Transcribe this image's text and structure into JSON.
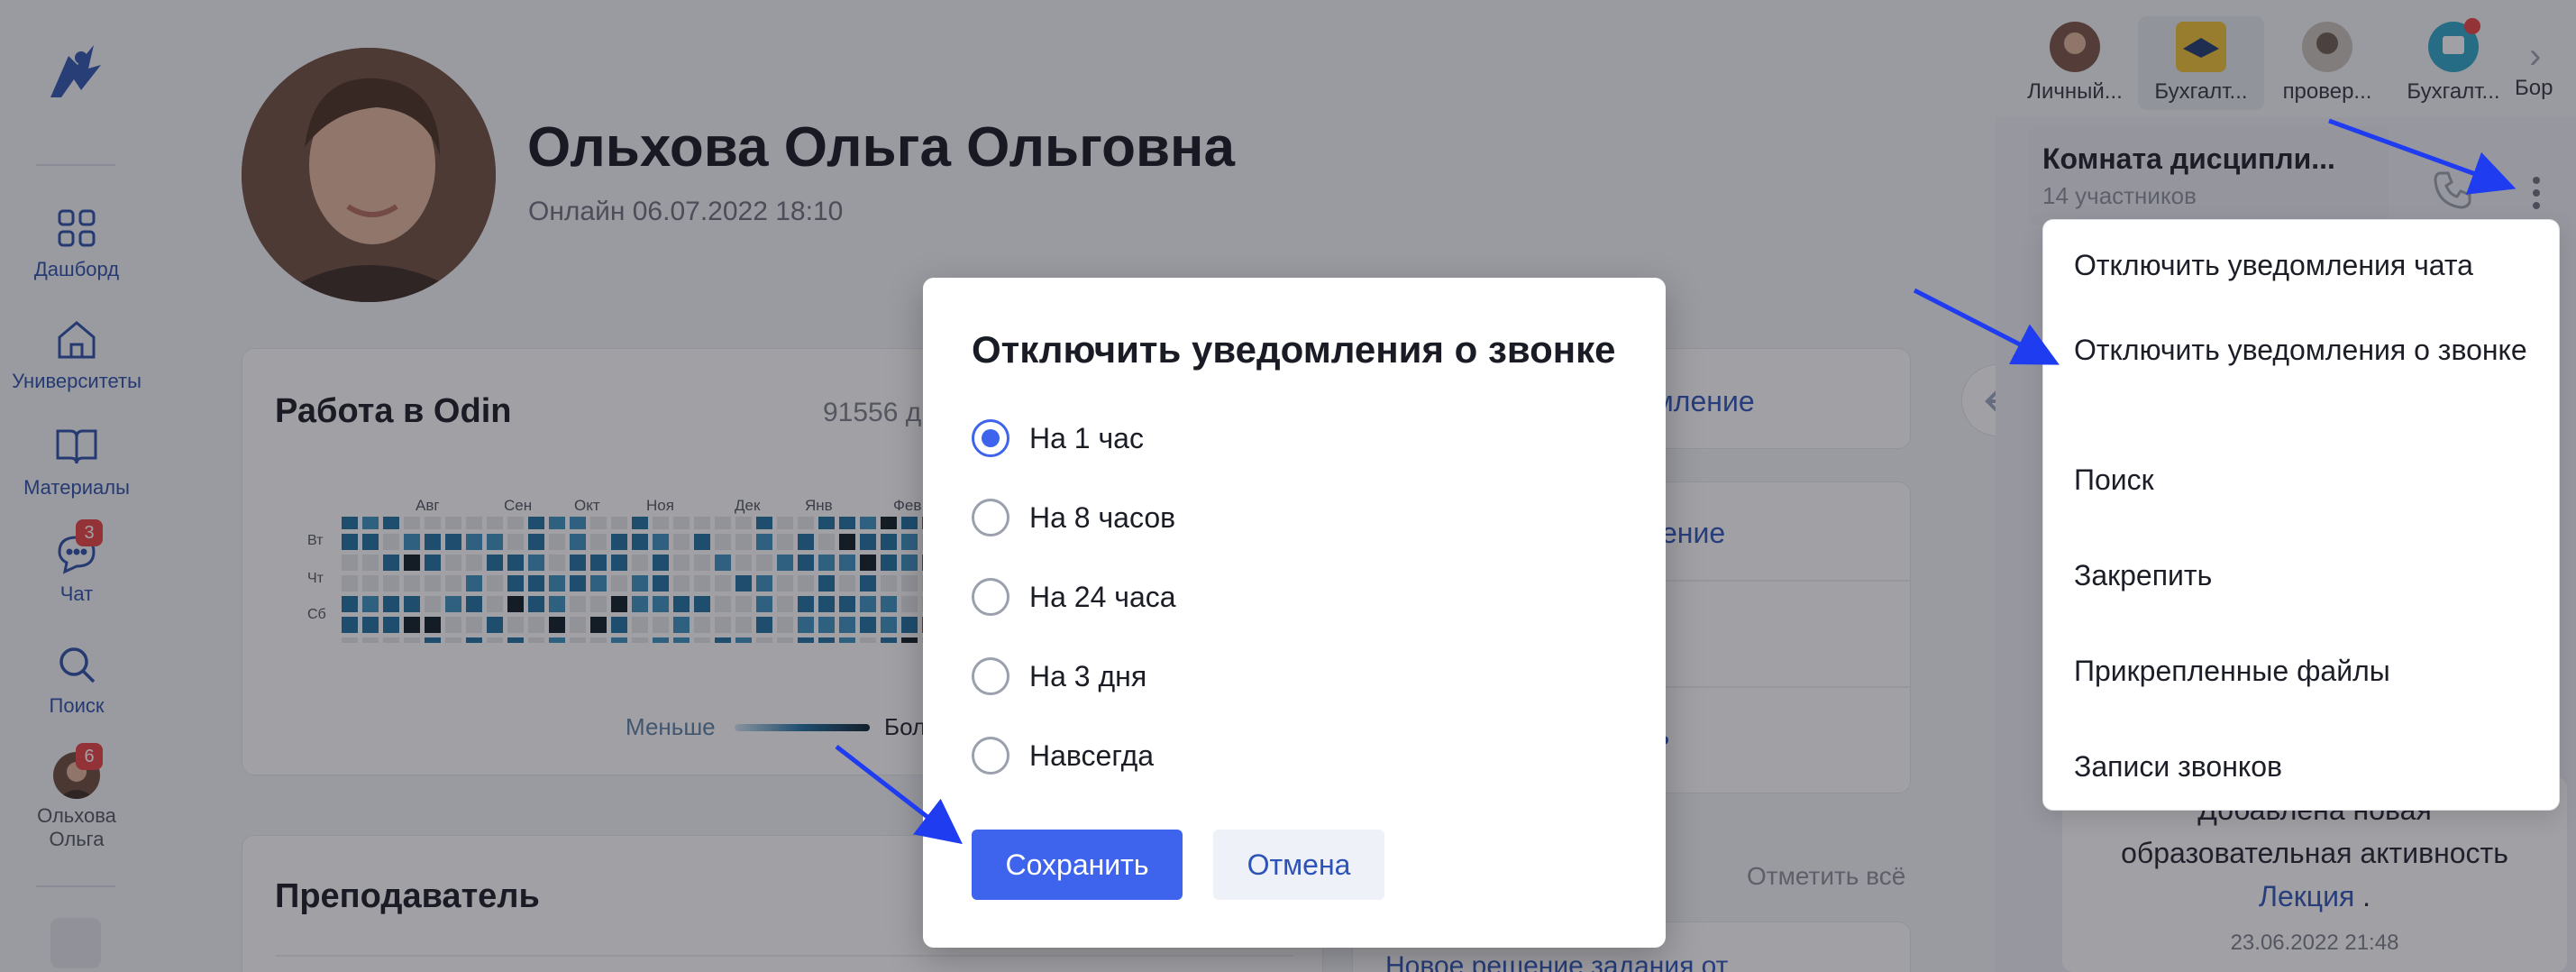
{
  "sidebar": {
    "items": [
      {
        "label": "Дашборд",
        "icon": "grid-icon"
      },
      {
        "label": "Университеты",
        "icon": "home-icon"
      },
      {
        "label": "Материалы",
        "icon": "book-icon"
      },
      {
        "label": "Чат",
        "icon": "chat-icon",
        "badge": "3"
      },
      {
        "label": "Поиск",
        "icon": "search-icon"
      }
    ],
    "user": {
      "name_line1": "Ольхова",
      "name_line2": "Ольга",
      "badge": "6"
    }
  },
  "profile": {
    "name": "Ольхова Ольга Ольговна",
    "status": "Онлайн 06.07.2022 18:10"
  },
  "odin_card": {
    "title": "Работа в Odin",
    "days": "91556 д",
    "months": [
      "Авг",
      "Сен",
      "Окт",
      "Ноя",
      "Дек",
      "Янв",
      "Фев"
    ],
    "days_labels": [
      "Вт",
      "Чт",
      "Сб"
    ],
    "legend_less": "Меньше",
    "legend_more": "Бол"
  },
  "teacher_card": {
    "title": "Преподаватель"
  },
  "mid": {
    "link1": "омление",
    "link2": "щение",
    "link3": "ль",
    "mark_all": "Отметить всё",
    "bottom_link": "Новое решение задания от"
  },
  "tabbar": {
    "items": [
      {
        "label": "Личный..."
      },
      {
        "label": "Бухгалт..."
      },
      {
        "label": "провер..."
      },
      {
        "label": "Бухгалт..."
      },
      {
        "label": "Бор"
      }
    ]
  },
  "chat": {
    "title": "Комната дисципли...",
    "subtitle": "14 участников"
  },
  "dropdown": {
    "items": [
      "Отключить уведомления чата",
      "Отключить уведомления о звонке",
      "Поиск",
      "Закрепить",
      "Прикрепленные файлы",
      "Записи звонков"
    ]
  },
  "feed": {
    "line1": "Добавлена новая",
    "line2": "образовательная активность",
    "link": "Лекция",
    "link_suffix": " .",
    "time": "23.06.2022 21:48"
  },
  "modal": {
    "title": "Отключить уведомления о звонке",
    "options": [
      "На 1 час",
      "На 8 часов",
      "На 24 часа",
      "На 3 дня",
      "Навсегда"
    ],
    "selected_index": 0,
    "save_label": "Сохранить",
    "cancel_label": "Отмена"
  },
  "colors": {
    "accent": "#3e64ee",
    "link": "#2d53b8",
    "badge": "#e84343",
    "annotation_arrow": "#1f3cf0"
  }
}
